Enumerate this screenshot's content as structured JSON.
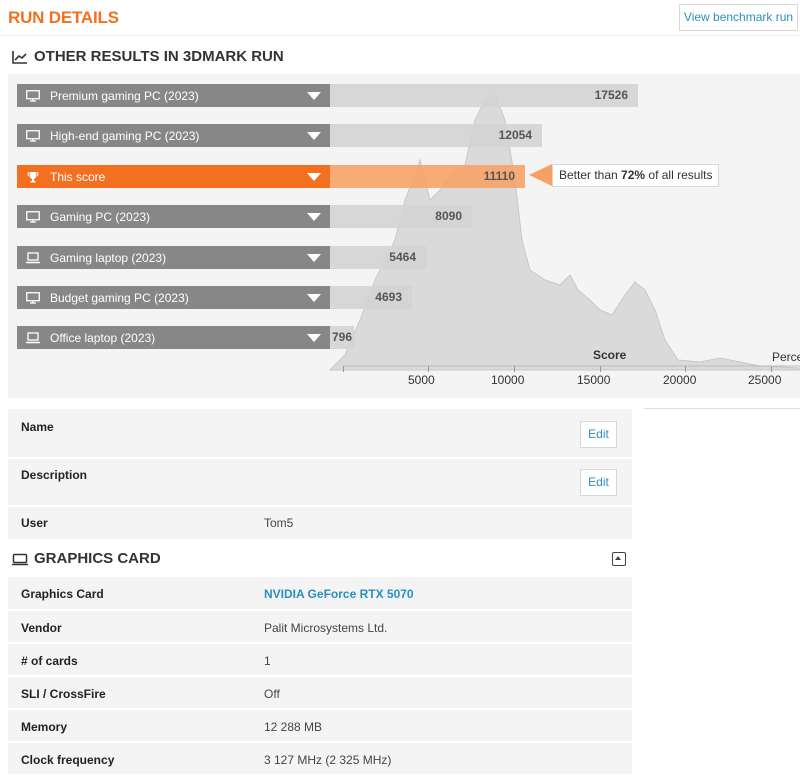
{
  "header": {
    "title": "RUN DETAILS",
    "benchmark_button": "View benchmark run"
  },
  "results": {
    "heading": "OTHER RESULTS IN 3DMARK RUN",
    "rows": [
      {
        "label": "Premium gaming PC (2023)",
        "score": "17526",
        "icon": "desktop-icon",
        "highlight": false
      },
      {
        "label": "High-end gaming PC (2023)",
        "score": "12054",
        "icon": "desktop-icon",
        "highlight": false
      },
      {
        "label": "This score",
        "score": "11110",
        "icon": "trophy-icon",
        "highlight": true
      },
      {
        "label": "Gaming PC (2023)",
        "score": "8090",
        "icon": "desktop-icon",
        "highlight": false
      },
      {
        "label": "Gaming laptop (2023)",
        "score": "5464",
        "icon": "laptop-icon",
        "highlight": false
      },
      {
        "label": "Budget gaming PC (2023)",
        "score": "4693",
        "icon": "desktop-icon",
        "highlight": false
      },
      {
        "label": "Office laptop (2023)",
        "score": "796",
        "icon": "laptop-icon",
        "highlight": false
      }
    ],
    "callout": {
      "prefix": "Better than ",
      "percent": "72%",
      "suffix": " of all results"
    },
    "axis": {
      "title": "Score",
      "right_label": "Perce",
      "ticks": [
        "5000",
        "10000",
        "15000",
        "20000",
        "25000"
      ]
    }
  },
  "details": {
    "rows": [
      {
        "key": "Name",
        "value": "",
        "edit": "Edit"
      },
      {
        "key": "Description",
        "value": "",
        "edit": "Edit"
      },
      {
        "key": "User",
        "value": "Tom5"
      }
    ]
  },
  "graphics_card": {
    "heading": "GRAPHICS CARD",
    "rows": [
      {
        "key": "Graphics Card",
        "value": "NVIDIA GeForce RTX 5070",
        "link": true
      },
      {
        "key": "Vendor",
        "value": "Palit Microsystems Ltd."
      },
      {
        "key": "# of cards",
        "value": "1"
      },
      {
        "key": "SLI / CrossFire",
        "value": "Off"
      },
      {
        "key": "Memory",
        "value": "12 288 MB"
      },
      {
        "key": "Clock frequency",
        "value": "3 127 MHz (2 325 MHz)"
      }
    ]
  },
  "colors": {
    "accent": "#f37021",
    "link": "#2a8fbd",
    "row_gray": "#878787"
  }
}
